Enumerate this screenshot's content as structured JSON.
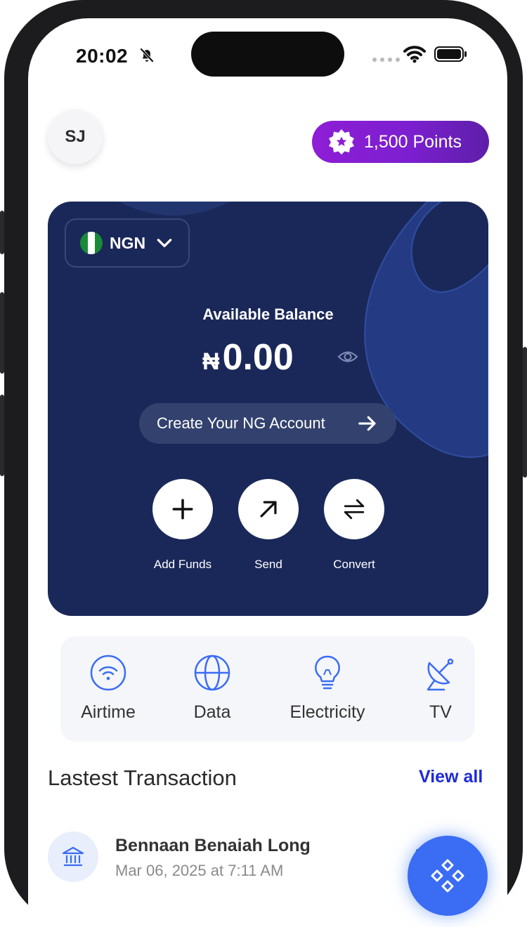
{
  "status_bar": {
    "time": "20:02"
  },
  "header": {
    "avatar_initials": "SJ",
    "points_label": "1,500 Points",
    "points_gradient": [
      "#8e1ed6",
      "#5d1fa8"
    ]
  },
  "balance_card": {
    "background": "#1a2859",
    "currency": {
      "code": "NGN",
      "flag": "nigeria-flag-icon"
    },
    "label": "Available Balance",
    "currency_symbol": "₦",
    "amount": "0.00",
    "create_account_label": "Create Your NG Account",
    "actions": [
      {
        "label": "Add Funds",
        "icon": "plus-icon"
      },
      {
        "label": "Send",
        "icon": "arrow-up-right-icon"
      },
      {
        "label": "Convert",
        "icon": "swap-arrows-icon"
      }
    ]
  },
  "services": [
    {
      "label": "Airtime",
      "icon": "wifi-icon"
    },
    {
      "label": "Data",
      "icon": "globe-icon"
    },
    {
      "label": "Electricity",
      "icon": "lightbulb-icon"
    },
    {
      "label": "TV",
      "icon": "satellite-dish-icon"
    }
  ],
  "transactions": {
    "title": "Lastest Transaction",
    "view_all_label": "View all",
    "items": [
      {
        "name": "Bennaan Benaiah Long",
        "date": "Mar 06, 2025 at 7:11 AM",
        "amount": "0",
        "icon": "bank-icon"
      }
    ]
  },
  "accent_color": "#3a6cf4",
  "link_color": "#1d2bd8"
}
